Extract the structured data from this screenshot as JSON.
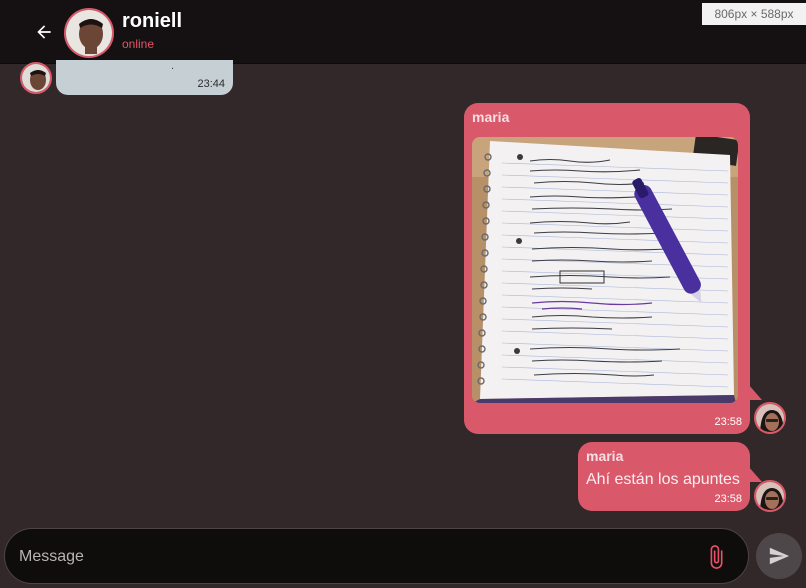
{
  "header": {
    "contact_name": "roniell",
    "status": "online"
  },
  "overlay": {
    "dimensions": "806px × 588px"
  },
  "messages": [
    {
      "direction": "in",
      "time": "23:44",
      "text_fragment": "."
    },
    {
      "direction": "out",
      "sender": "maria",
      "type": "image",
      "time": "23:58"
    },
    {
      "direction": "out",
      "sender": "maria",
      "type": "text",
      "text": "Ahí están los apuntes",
      "time": "23:58"
    }
  ],
  "composer": {
    "placeholder": "Message"
  },
  "icons": {
    "back": "arrow-left-icon",
    "attach": "paperclip-icon",
    "send": "send-icon"
  },
  "colors": {
    "accent": "#d9596b",
    "background": "#332829",
    "header": "#151112",
    "incoming_bubble": "#c6cfd4",
    "status": "#e55466"
  }
}
